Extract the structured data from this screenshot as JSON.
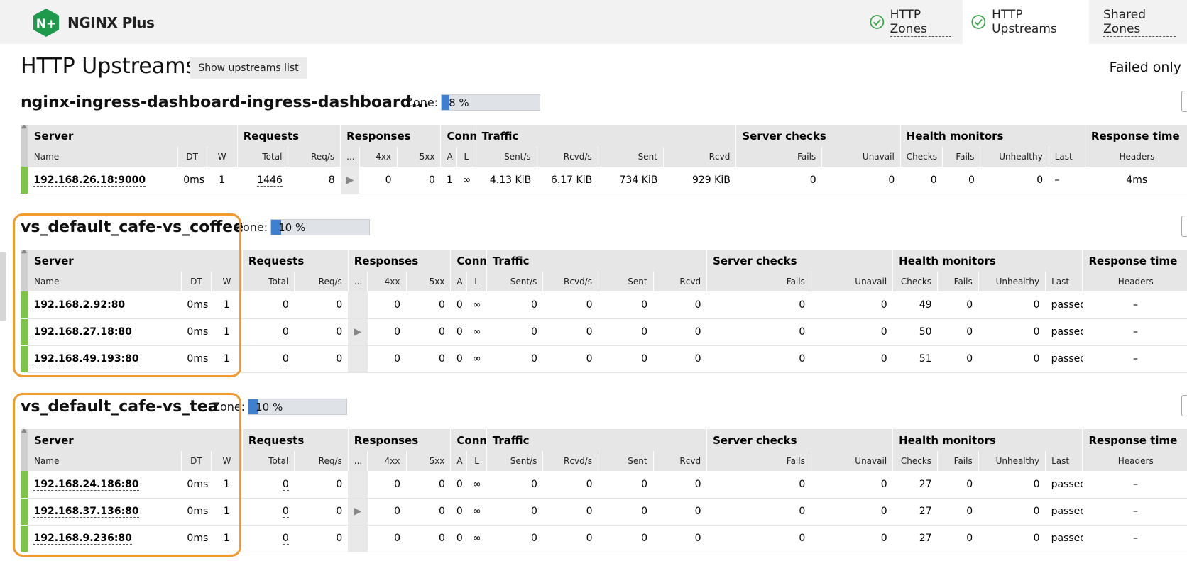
{
  "app": {
    "logo_text": "NGINX Plus",
    "logo_badge_text": "N+"
  },
  "tabs": [
    {
      "label": "HTTP Zones",
      "status": "ok",
      "active": false
    },
    {
      "label": "HTTP Upstreams",
      "status": "ok",
      "active": true
    },
    {
      "label": "Shared Zones",
      "status": "none",
      "active": false
    }
  ],
  "page": {
    "title": "HTTP Upstreams",
    "show_list_button": "Show upstreams list",
    "failed_only": "Failed only"
  },
  "zone_label": "Zone:",
  "headers": {
    "groups": [
      "Server",
      "Requests",
      "Responses",
      "Conns",
      "Traffic",
      "Server checks",
      "Health monitors",
      "Response time"
    ],
    "sub": [
      "Name",
      "DT",
      "W",
      "Total",
      "Req/s",
      "...",
      "4xx",
      "5xx",
      "A",
      "L",
      "Sent/s",
      "Rcvd/s",
      "Sent",
      "Rcvd",
      "Fails",
      "Unavail",
      "Checks",
      "Fails",
      "Unhealthy",
      "Last",
      "Headers"
    ]
  },
  "upstreams": [
    {
      "name": "nginx-ingress-dashboard-ingress-dashboard...",
      "zone": "8 %",
      "zone_pct": 8,
      "rows": [
        {
          "server": "192.168.26.18:9000",
          "dt": "0ms",
          "w": "1",
          "total": "1446",
          "reqs": "8",
          "x4": "0",
          "x5": "0",
          "a": "1",
          "l": "∞",
          "sents": "4.13 KiB",
          "rcvds": "6.17 KiB",
          "sent": "734 KiB",
          "rcvd": "929 KiB",
          "sc_fails": "0",
          "unavail": "0",
          "checks": "0",
          "hm_fails": "0",
          "unhealthy": "0",
          "last": "–",
          "headers": "4ms"
        }
      ]
    },
    {
      "name": "vs_default_cafe-vs_coffee",
      "zone": "10 %",
      "zone_pct": 10,
      "rows": [
        {
          "server": "192.168.2.92:80",
          "dt": "0ms",
          "w": "1",
          "total": "0",
          "reqs": "0",
          "x4": "0",
          "x5": "0",
          "a": "0",
          "l": "∞",
          "sents": "0",
          "rcvds": "0",
          "sent": "0",
          "rcvd": "0",
          "sc_fails": "0",
          "unavail": "0",
          "checks": "49",
          "hm_fails": "0",
          "unhealthy": "0",
          "last": "passed",
          "headers": "–"
        },
        {
          "server": "192.168.27.18:80",
          "dt": "0ms",
          "w": "1",
          "total": "0",
          "reqs": "0",
          "x4": "0",
          "x5": "0",
          "a": "0",
          "l": "∞",
          "sents": "0",
          "rcvds": "0",
          "sent": "0",
          "rcvd": "0",
          "sc_fails": "0",
          "unavail": "0",
          "checks": "50",
          "hm_fails": "0",
          "unhealthy": "0",
          "last": "passed",
          "headers": "–"
        },
        {
          "server": "192.168.49.193:80",
          "dt": "0ms",
          "w": "1",
          "total": "0",
          "reqs": "0",
          "x4": "0",
          "x5": "0",
          "a": "0",
          "l": "∞",
          "sents": "0",
          "rcvds": "0",
          "sent": "0",
          "rcvd": "0",
          "sc_fails": "0",
          "unavail": "0",
          "checks": "51",
          "hm_fails": "0",
          "unhealthy": "0",
          "last": "passed",
          "headers": "–"
        }
      ]
    },
    {
      "name": "vs_default_cafe-vs_tea",
      "zone": "10 %",
      "zone_pct": 10,
      "rows": [
        {
          "server": "192.168.24.186:80",
          "dt": "0ms",
          "w": "1",
          "total": "0",
          "reqs": "0",
          "x4": "0",
          "x5": "0",
          "a": "0",
          "l": "∞",
          "sents": "0",
          "rcvds": "0",
          "sent": "0",
          "rcvd": "0",
          "sc_fails": "0",
          "unavail": "0",
          "checks": "27",
          "hm_fails": "0",
          "unhealthy": "0",
          "last": "passed",
          "headers": "–"
        },
        {
          "server": "192.168.37.136:80",
          "dt": "0ms",
          "w": "1",
          "total": "0",
          "reqs": "0",
          "x4": "0",
          "x5": "0",
          "a": "0",
          "l": "∞",
          "sents": "0",
          "rcvds": "0",
          "sent": "0",
          "rcvd": "0",
          "sc_fails": "0",
          "unavail": "0",
          "checks": "27",
          "hm_fails": "0",
          "unhealthy": "0",
          "last": "passed",
          "headers": "–"
        },
        {
          "server": "192.168.9.236:80",
          "dt": "0ms",
          "w": "1",
          "total": "0",
          "reqs": "0",
          "x4": "0",
          "x5": "0",
          "a": "0",
          "l": "∞",
          "sents": "0",
          "rcvds": "0",
          "sent": "0",
          "rcvd": "0",
          "sc_fails": "0",
          "unavail": "0",
          "checks": "27",
          "hm_fails": "0",
          "unhealthy": "0",
          "last": "passed",
          "headers": "–"
        }
      ]
    }
  ],
  "colors": {
    "status_up": "#7cc547",
    "zone_fill": "#3f7fd0",
    "highlight": "#f39a2e",
    "logo_green": "#1f9a4c"
  }
}
